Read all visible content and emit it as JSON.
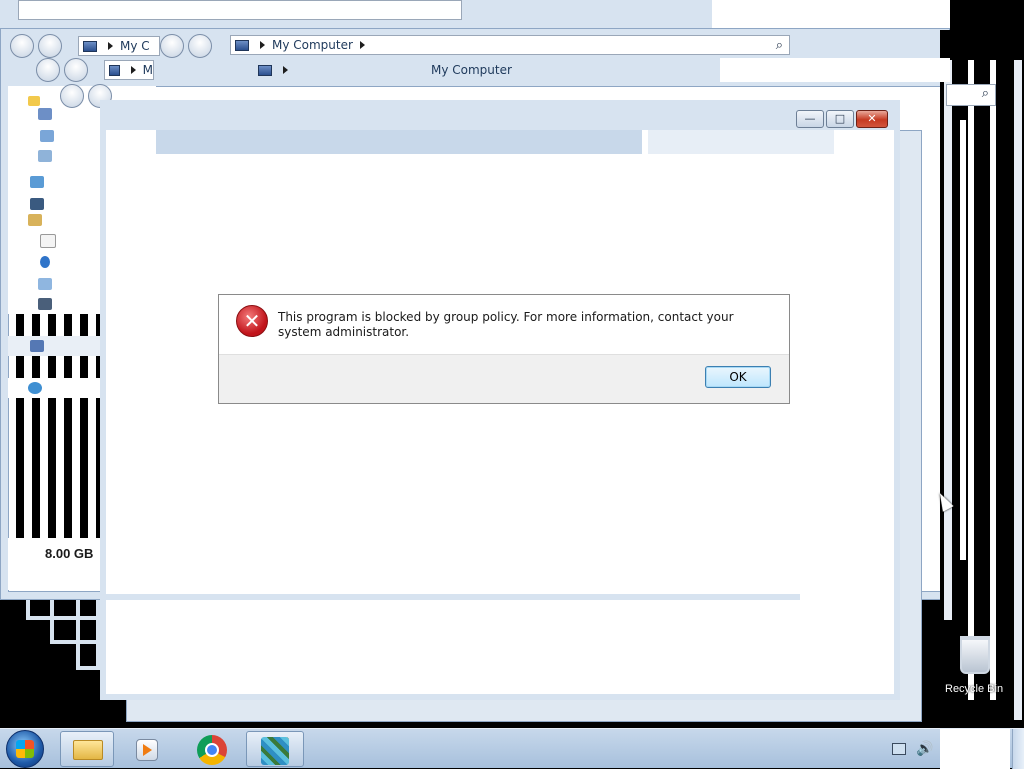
{
  "explorer": {
    "breadcrumb_root": "My Computer",
    "breadcrumb_secondary": "My Computer",
    "truncated_breadcrumb": "My C",
    "truncated_m": "M",
    "ram_total": "8.00 GB"
  },
  "dialog": {
    "message": "This program is blocked by group policy. For more information, contact your system administrator.",
    "ok_label": "OK",
    "title_buttons": {
      "minimize": "—",
      "maximize": "□",
      "close": "✕"
    }
  },
  "desktop": {
    "recycle_bin_label": "Recycle Bin"
  },
  "taskbar": {
    "items": [
      "start-orb",
      "explorer",
      "media-player",
      "chrome",
      "registry-editor"
    ],
    "active_item": "registry-editor"
  },
  "colors": {
    "taskbar": "#b9cee6",
    "glass": "#d7e3f0",
    "error_red": "#c1141b",
    "ok_button_border": "#3c7fb1"
  }
}
